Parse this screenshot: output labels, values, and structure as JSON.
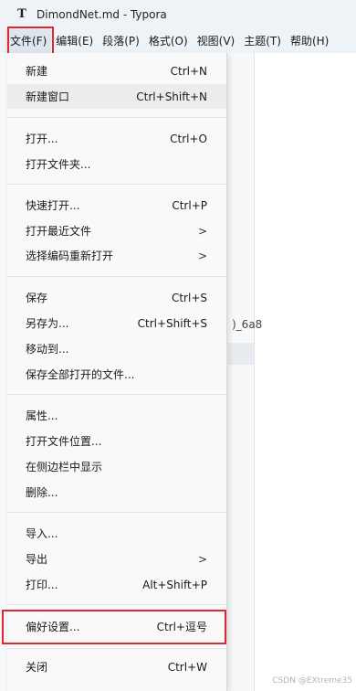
{
  "window": {
    "title": "DimondNet.md - Typora",
    "logo_letter": "T"
  },
  "menubar": {
    "items": [
      "文件(F)",
      "编辑(E)",
      "段落(P)",
      "格式(O)",
      "视图(V)",
      "主题(T)",
      "帮助(H)"
    ]
  },
  "background": {
    "partial_text": ")_6a8"
  },
  "file_menu": {
    "new": {
      "label": "新建",
      "shortcut": "Ctrl+N"
    },
    "new_window": {
      "label": "新建窗口",
      "shortcut": "Ctrl+Shift+N"
    },
    "open": {
      "label": "打开...",
      "shortcut": "Ctrl+O"
    },
    "open_folder": {
      "label": "打开文件夹...",
      "shortcut": ""
    },
    "quick_open": {
      "label": "快速打开...",
      "shortcut": "Ctrl+P"
    },
    "open_recent": {
      "label": "打开最近文件",
      "arrow": ">"
    },
    "reopen_encoding": {
      "label": "选择编码重新打开",
      "arrow": ">"
    },
    "save": {
      "label": "保存",
      "shortcut": "Ctrl+S"
    },
    "save_as": {
      "label": "另存为...",
      "shortcut": "Ctrl+Shift+S"
    },
    "move_to": {
      "label": "移动到...",
      "shortcut": ""
    },
    "save_all": {
      "label": "保存全部打开的文件...",
      "shortcut": ""
    },
    "properties": {
      "label": "属性...",
      "shortcut": ""
    },
    "open_location": {
      "label": "打开文件位置...",
      "shortcut": ""
    },
    "reveal_sidebar": {
      "label": "在侧边栏中显示",
      "shortcut": ""
    },
    "delete": {
      "label": "删除...",
      "shortcut": ""
    },
    "import": {
      "label": "导入...",
      "shortcut": ""
    },
    "export": {
      "label": "导出",
      "arrow": ">"
    },
    "print": {
      "label": "打印...",
      "shortcut": "Alt+Shift+P"
    },
    "preferences": {
      "label": "偏好设置...",
      "shortcut": "Ctrl+逗号"
    },
    "close": {
      "label": "关闭",
      "shortcut": "Ctrl+W"
    }
  },
  "watermark": "CSDN @EXtreme35"
}
